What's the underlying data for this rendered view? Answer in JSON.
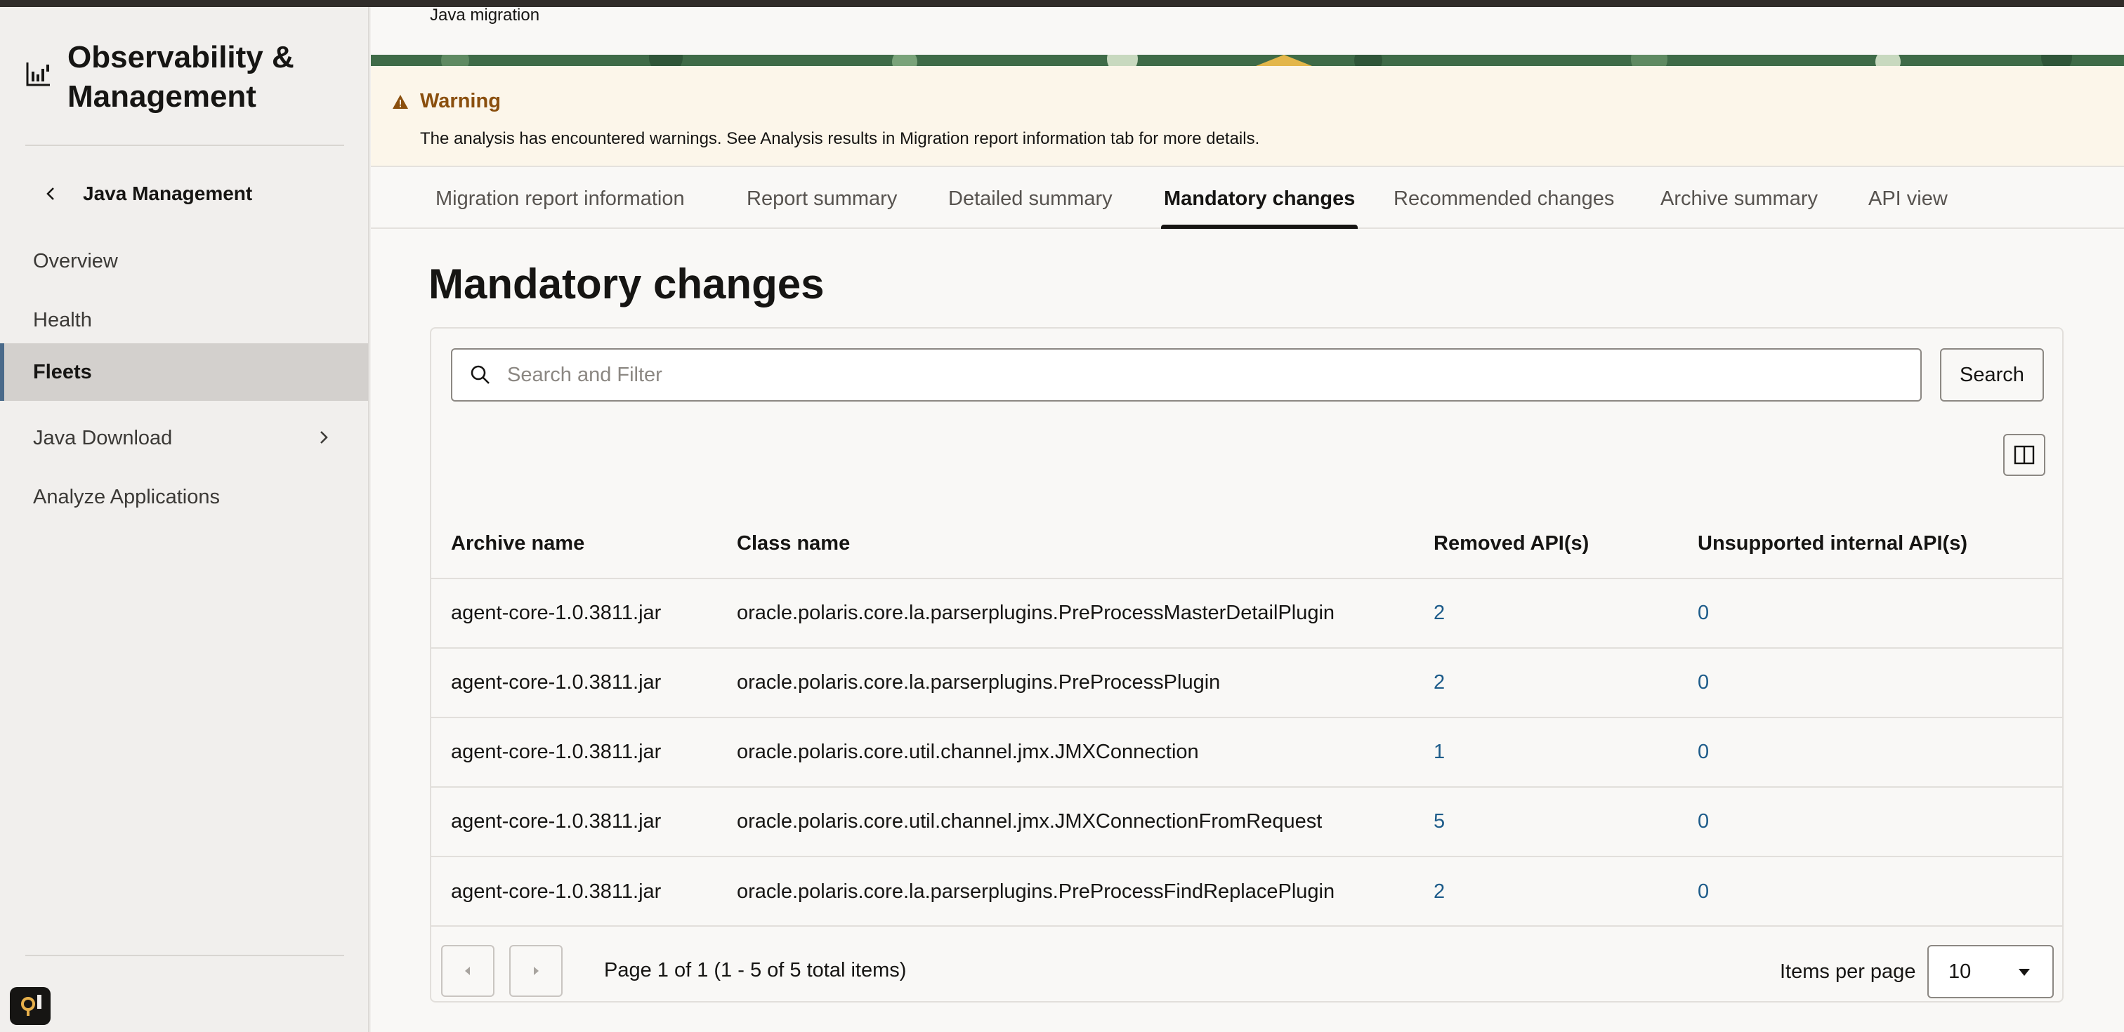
{
  "app": {
    "brand_title": "Observability & Management",
    "back_label": "Java Management"
  },
  "sidebar": {
    "items": [
      {
        "label": "Overview"
      },
      {
        "label": "Health"
      },
      {
        "label": "Fleets",
        "active": true
      },
      {
        "label": "Java Download",
        "has_submenu": true
      },
      {
        "label": "Analyze Applications"
      }
    ]
  },
  "header": {
    "breadcrumb": "Java migration"
  },
  "warning": {
    "title": "Warning",
    "message": "The analysis has encountered warnings. See Analysis results in Migration report information tab for more details."
  },
  "tabs": [
    {
      "label": "Migration report information"
    },
    {
      "label": "Report summary"
    },
    {
      "label": "Detailed summary"
    },
    {
      "label": "Mandatory changes",
      "active": true
    },
    {
      "label": "Recommended changes"
    },
    {
      "label": "Archive summary"
    },
    {
      "label": "API view"
    }
  ],
  "page": {
    "title": "Mandatory changes"
  },
  "search": {
    "placeholder": "Search and Filter",
    "value": "",
    "button_label": "Search"
  },
  "table": {
    "columns": [
      "Archive name",
      "Class name",
      "Removed API(s)",
      "Unsupported internal API(s)"
    ],
    "rows": [
      {
        "archive": "agent-core-1.0.3811.jar",
        "class": "oracle.polaris.core.la.parserplugins.PreProcessMasterDetailPlugin",
        "removed": "2",
        "unsupported": "0"
      },
      {
        "archive": "agent-core-1.0.3811.jar",
        "class": "oracle.polaris.core.la.parserplugins.PreProcessPlugin",
        "removed": "2",
        "unsupported": "0"
      },
      {
        "archive": "agent-core-1.0.3811.jar",
        "class": "oracle.polaris.core.util.channel.jmx.JMXConnection",
        "removed": "1",
        "unsupported": "0"
      },
      {
        "archive": "agent-core-1.0.3811.jar",
        "class": "oracle.polaris.core.util.channel.jmx.JMXConnectionFromRequest",
        "removed": "5",
        "unsupported": "0"
      },
      {
        "archive": "agent-core-1.0.3811.jar",
        "class": "oracle.polaris.core.la.parserplugins.PreProcessFindReplacePlugin",
        "removed": "2",
        "unsupported": "0"
      }
    ]
  },
  "pagination": {
    "status": "Page 1 of 1 (1 - 5 of 5 total items)",
    "items_per_page_label": "Items per page",
    "items_per_page_value": "10"
  },
  "colors": {
    "link": "#1e5c8a",
    "warning_title": "#8a4f0e",
    "warning_bg": "#fcf6ea",
    "active_nav_bg": "#d3d0cd"
  }
}
